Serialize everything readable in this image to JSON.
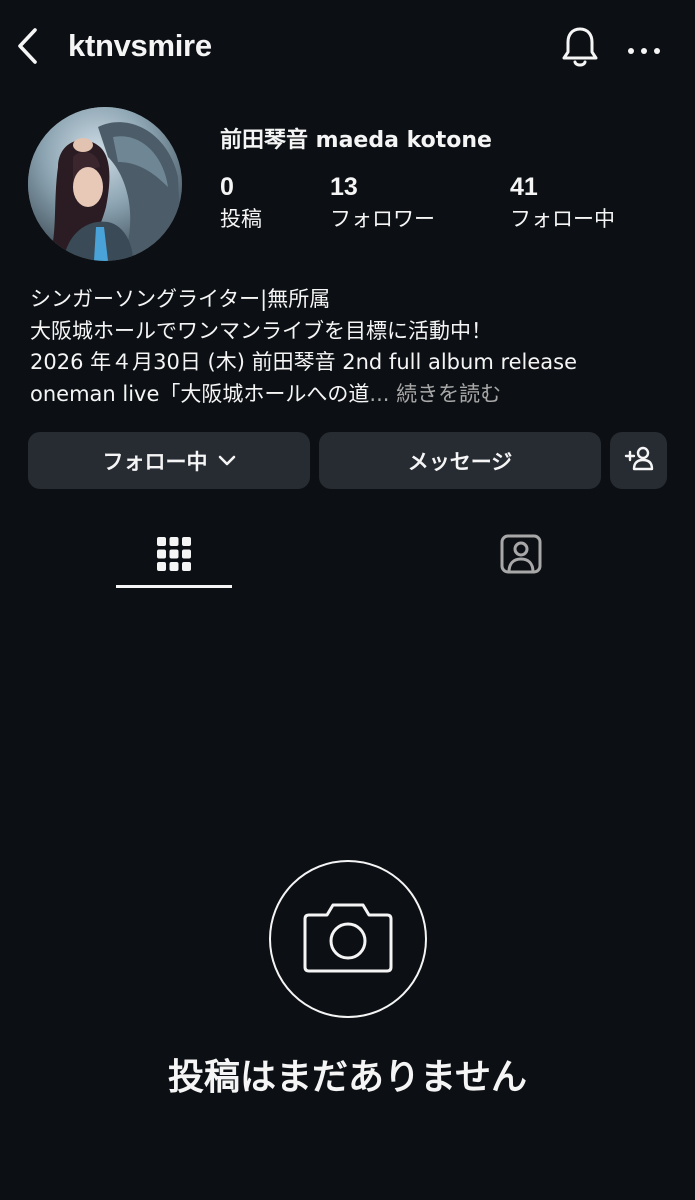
{
  "header": {
    "username": "ktnvsmire",
    "back_icon": "chevron-left-icon",
    "bell_icon": "bell-icon",
    "more_icon": "more-horizontal-icon"
  },
  "profile": {
    "display_name": "前田琴音 maeda kotone",
    "stats": {
      "posts": {
        "value": "0",
        "label": "投稿"
      },
      "followers": {
        "value": "13",
        "label": "フォロワー"
      },
      "following": {
        "value": "41",
        "label": "フォロー中"
      }
    }
  },
  "bio": {
    "line1": "シンガーソングライター|無所属",
    "line2": "大阪城ホールでワンマンライブを目標に活動中！",
    "line3": "2026 年４月30日 (木) 前田琴音 2nd full album release",
    "line4": "oneman live「大阪城ホールへの道",
    "ellipsis": "...",
    "more": "続きを読む"
  },
  "actions": {
    "following_label": "フォロー中",
    "message_label": "メッセージ",
    "add_icon": "add-person-icon"
  },
  "tabs": {
    "grid_icon": "grid-icon",
    "tagged_icon": "tagged-person-icon"
  },
  "empty": {
    "icon": "camera-icon",
    "text": "投稿はまだありません"
  },
  "colors": {
    "background": "#0c1014",
    "button": "#272c33",
    "text": "#f5f5f5",
    "muted": "#a8a8a8"
  }
}
